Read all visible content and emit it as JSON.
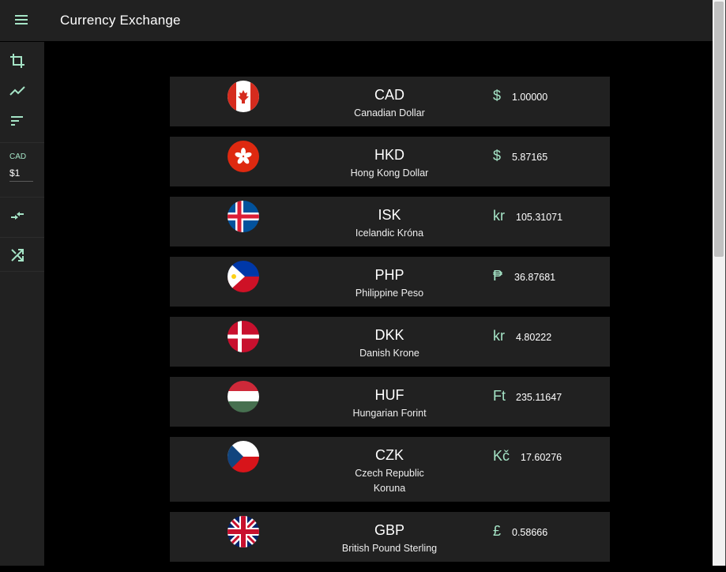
{
  "app": {
    "title": "Currency Exchange"
  },
  "sidebar": {
    "base_currency": "CAD",
    "amount_value": "$1"
  },
  "currencies": [
    {
      "code": "CAD",
      "name": "Canadian Dollar",
      "symbol": "$",
      "rate": "1.00000"
    },
    {
      "code": "HKD",
      "name": "Hong Kong Dollar",
      "symbol": "$",
      "rate": "5.87165"
    },
    {
      "code": "ISK",
      "name": "Icelandic Króna",
      "symbol": "kr",
      "rate": "105.31071"
    },
    {
      "code": "PHP",
      "name": "Philippine Peso",
      "symbol": "₱",
      "rate": "36.87681"
    },
    {
      "code": "DKK",
      "name": "Danish Krone",
      "symbol": "kr",
      "rate": "4.80222"
    },
    {
      "code": "HUF",
      "name": "Hungarian Forint",
      "symbol": "Ft",
      "rate": "235.11647"
    },
    {
      "code": "CZK",
      "name": "Czech Republic Koruna",
      "symbol": "Kč",
      "rate": "17.60276"
    },
    {
      "code": "GBP",
      "name": "British Pound Sterling",
      "symbol": "£",
      "rate": "0.58666"
    }
  ],
  "colors": {
    "accent": "#a5e4c6",
    "surface": "#212121",
    "background": "#000000"
  }
}
